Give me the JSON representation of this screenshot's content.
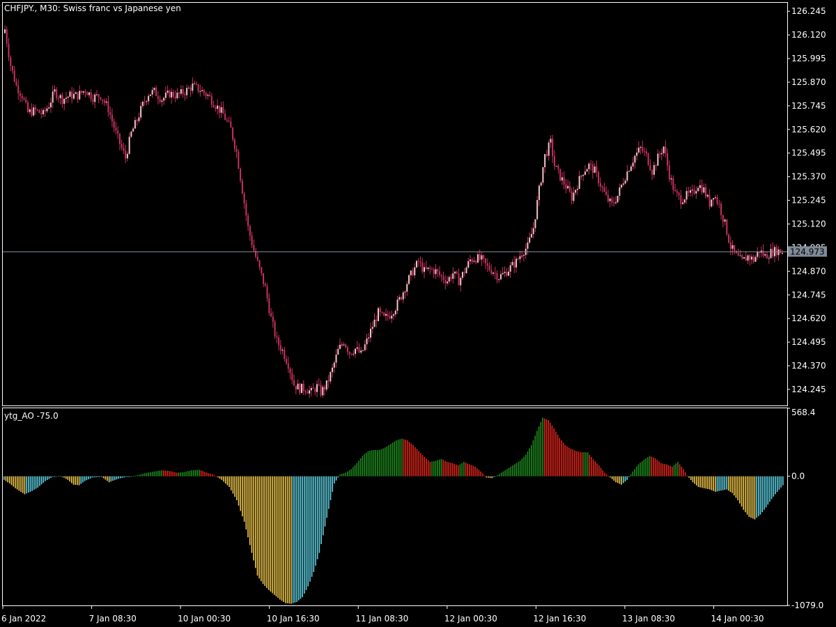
{
  "window": {
    "symbol": "CHFJPY.",
    "timeframe": "M30",
    "description": "Swiss franc vs Japanese yen",
    "title": "CHFJPY., M30:  Swiss franc vs Japanese yen"
  },
  "colors": {
    "background": "#000000",
    "frame": "#ffffff",
    "bull_candle_body": "#f2c7c7",
    "bear_candle_body": "#c8325f",
    "candle_wick": "#c8325f",
    "current_price_line": "#7f8b97",
    "current_price_tag": "#7f8b97",
    "ao_above_up": "#1e8c1e",
    "ao_above_down": "#e0251b",
    "ao_below_up": "#5fd3e6",
    "ao_below_down": "#f2c94c"
  },
  "chart_data": [
    {
      "type": "candlestick",
      "title": "CHFJPY., M30:  Swiss franc vs Japanese yen",
      "ylim": [
        124.16,
        126.29
      ],
      "yticks": [
        "126.245",
        "126.120",
        "125.995",
        "125.870",
        "125.745",
        "125.620",
        "125.495",
        "125.370",
        "125.245",
        "125.120",
        "124.995",
        "124.870",
        "124.745",
        "124.620",
        "124.495",
        "124.370",
        "124.245"
      ],
      "current_price": "124.973",
      "grid": false,
      "xticks": [
        "6 Jan 2022",
        "7 Jan 08:30",
        "10 Jan 00:30",
        "10 Jan 16:30",
        "11 Jan 08:30",
        "12 Jan 00:30",
        "12 Jan 16:30",
        "13 Jan 08:30",
        "14 Jan 00:30"
      ],
      "close_anchors": [
        [
          0,
          126.15
        ],
        [
          3,
          125.96
        ],
        [
          6,
          125.85
        ],
        [
          9,
          125.8
        ],
        [
          12,
          125.71
        ],
        [
          16,
          125.72
        ],
        [
          20,
          125.7
        ],
        [
          23,
          125.75
        ],
        [
          26,
          125.82
        ],
        [
          30,
          125.78
        ],
        [
          34,
          125.8
        ],
        [
          38,
          125.8
        ],
        [
          42,
          125.83
        ],
        [
          46,
          125.79
        ],
        [
          50,
          125.8
        ],
        [
          54,
          125.73
        ],
        [
          58,
          125.6
        ],
        [
          61,
          125.52
        ],
        [
          63,
          125.47
        ],
        [
          66,
          125.6
        ],
        [
          69,
          125.67
        ],
        [
          72,
          125.75
        ],
        [
          75,
          125.81
        ],
        [
          78,
          125.82
        ],
        [
          82,
          125.78
        ],
        [
          86,
          125.81
        ],
        [
          90,
          125.8
        ],
        [
          94,
          125.82
        ],
        [
          98,
          125.85
        ],
        [
          102,
          125.83
        ],
        [
          106,
          125.8
        ],
        [
          110,
          125.75
        ],
        [
          114,
          125.7
        ],
        [
          118,
          125.62
        ],
        [
          121,
          125.5
        ],
        [
          124,
          125.3
        ],
        [
          127,
          125.1
        ],
        [
          130,
          124.98
        ],
        [
          133,
          124.88
        ],
        [
          136,
          124.78
        ],
        [
          139,
          124.62
        ],
        [
          142,
          124.5
        ],
        [
          145,
          124.45
        ],
        [
          148,
          124.38
        ],
        [
          151,
          124.27
        ],
        [
          154,
          124.25
        ],
        [
          157,
          124.25
        ],
        [
          160,
          124.23
        ],
        [
          163,
          124.26
        ],
        [
          165,
          124.23
        ],
        [
          168,
          124.27
        ],
        [
          171,
          124.35
        ],
        [
          174,
          124.45
        ],
        [
          177,
          124.5
        ],
        [
          180,
          124.44
        ],
        [
          183,
          124.46
        ],
        [
          186,
          124.43
        ],
        [
          189,
          124.5
        ],
        [
          192,
          124.58
        ],
        [
          195,
          124.65
        ],
        [
          198,
          124.62
        ],
        [
          201,
          124.64
        ],
        [
          204,
          124.68
        ],
        [
          207,
          124.74
        ],
        [
          210,
          124.81
        ],
        [
          213,
          124.87
        ],
        [
          216,
          124.92
        ],
        [
          219,
          124.87
        ],
        [
          222,
          124.88
        ],
        [
          225,
          124.87
        ],
        [
          228,
          124.84
        ],
        [
          231,
          124.82
        ],
        [
          234,
          124.86
        ],
        [
          237,
          124.82
        ],
        [
          240,
          124.87
        ],
        [
          243,
          124.93
        ],
        [
          246,
          124.94
        ],
        [
          249,
          124.93
        ],
        [
          252,
          124.89
        ],
        [
          255,
          124.87
        ],
        [
          258,
          124.84
        ],
        [
          261,
          124.86
        ],
        [
          264,
          124.89
        ],
        [
          267,
          124.92
        ],
        [
          270,
          124.97
        ],
        [
          273,
          125.0
        ],
        [
          276,
          125.1
        ],
        [
          279,
          125.3
        ],
        [
          282,
          125.48
        ],
        [
          285,
          125.55
        ],
        [
          287,
          125.43
        ],
        [
          290,
          125.37
        ],
        [
          293,
          125.32
        ],
        [
          296,
          125.26
        ],
        [
          299,
          125.33
        ],
        [
          302,
          125.4
        ],
        [
          305,
          125.43
        ],
        [
          308,
          125.4
        ],
        [
          311,
          125.33
        ],
        [
          314,
          125.26
        ],
        [
          317,
          125.22
        ],
        [
          320,
          125.27
        ],
        [
          323,
          125.35
        ],
        [
          326,
          125.42
        ],
        [
          329,
          125.48
        ],
        [
          332,
          125.52
        ],
        [
          335,
          125.48
        ],
        [
          338,
          125.4
        ],
        [
          341,
          125.47
        ],
        [
          344,
          125.53
        ],
        [
          347,
          125.38
        ],
        [
          350,
          125.28
        ],
        [
          353,
          125.25
        ],
        [
          356,
          125.27
        ],
        [
          359,
          125.28
        ],
        [
          362,
          125.33
        ],
        [
          365,
          125.3
        ],
        [
          368,
          125.23
        ],
        [
          370,
          125.28
        ],
        [
          373,
          125.22
        ],
        [
          376,
          125.12
        ],
        [
          379,
          125.0
        ],
        [
          382,
          124.95
        ],
        [
          385,
          124.92
        ],
        [
          388,
          124.95
        ],
        [
          391,
          124.93
        ],
        [
          394,
          124.98
        ],
        [
          397,
          124.95
        ],
        [
          400,
          124.97
        ],
        [
          403,
          124.98
        ],
        [
          406,
          124.973
        ]
      ]
    },
    {
      "type": "bar",
      "title": "ytg_AO -75.0",
      "ylim": [
        -1079.0,
        568.4
      ],
      "yticks": [
        "568.4",
        "0.0",
        "-1079.0"
      ],
      "series_name": "ytg_AO",
      "last_value": "-75.0",
      "anchors": [
        [
          0,
          -30
        ],
        [
          3,
          -60
        ],
        [
          6,
          -100
        ],
        [
          9,
          -130
        ],
        [
          11,
          -150
        ],
        [
          14,
          -130
        ],
        [
          18,
          -95
        ],
        [
          22,
          -40
        ],
        [
          26,
          -5
        ],
        [
          30,
          5
        ],
        [
          34,
          -30
        ],
        [
          37,
          -70
        ],
        [
          40,
          -75
        ],
        [
          43,
          -40
        ],
        [
          47,
          -10
        ],
        [
          52,
          -5
        ],
        [
          56,
          -50
        ],
        [
          61,
          -20
        ],
        [
          66,
          -3
        ],
        [
          70,
          5
        ],
        [
          75,
          25
        ],
        [
          80,
          40
        ],
        [
          84,
          50
        ],
        [
          88,
          45
        ],
        [
          92,
          30
        ],
        [
          96,
          35
        ],
        [
          100,
          50
        ],
        [
          104,
          55
        ],
        [
          108,
          30
        ],
        [
          112,
          10
        ],
        [
          116,
          -30
        ],
        [
          120,
          -90
        ],
        [
          124,
          -200
        ],
        [
          128,
          -380
        ],
        [
          132,
          -640
        ],
        [
          135,
          -830
        ],
        [
          138,
          -900
        ],
        [
          141,
          -950
        ],
        [
          144,
          -990
        ],
        [
          147,
          -1030
        ],
        [
          150,
          -1060
        ],
        [
          153,
          -1065
        ],
        [
          156,
          -1050
        ],
        [
          159,
          -1010
        ],
        [
          162,
          -920
        ],
        [
          165,
          -800
        ],
        [
          168,
          -640
        ],
        [
          171,
          -420
        ],
        [
          174,
          -200
        ],
        [
          176,
          -60
        ],
        [
          179,
          15
        ],
        [
          182,
          30
        ],
        [
          185,
          60
        ],
        [
          188,
          110
        ],
        [
          191,
          170
        ],
        [
          194,
          210
        ],
        [
          197,
          220
        ],
        [
          200,
          220
        ],
        [
          203,
          240
        ],
        [
          206,
          270
        ],
        [
          209,
          300
        ],
        [
          212,
          315
        ],
        [
          215,
          300
        ],
        [
          218,
          260
        ],
        [
          221,
          210
        ],
        [
          224,
          160
        ],
        [
          227,
          120
        ],
        [
          230,
          130
        ],
        [
          233,
          145
        ],
        [
          236,
          120
        ],
        [
          239,
          110
        ],
        [
          242,
          90
        ],
        [
          245,
          120
        ],
        [
          248,
          100
        ],
        [
          251,
          80
        ],
        [
          254,
          40
        ],
        [
          257,
          -10
        ],
        [
          260,
          -15
        ],
        [
          263,
          10
        ],
        [
          266,
          40
        ],
        [
          269,
          70
        ],
        [
          272,
          100
        ],
        [
          275,
          130
        ],
        [
          278,
          180
        ],
        [
          281,
          260
        ],
        [
          284,
          380
        ],
        [
          287,
          490
        ],
        [
          290,
          470
        ],
        [
          293,
          400
        ],
        [
          296,
          320
        ],
        [
          299,
          260
        ],
        [
          302,
          230
        ],
        [
          305,
          210
        ],
        [
          308,
          200
        ],
        [
          311,
          200
        ],
        [
          314,
          140
        ],
        [
          317,
          90
        ],
        [
          320,
          30
        ],
        [
          323,
          -10
        ],
        [
          326,
          -50
        ],
        [
          329,
          -70
        ],
        [
          332,
          -30
        ],
        [
          335,
          40
        ],
        [
          338,
          100
        ],
        [
          341,
          140
        ],
        [
          344,
          170
        ],
        [
          347,
          150
        ],
        [
          350,
          110
        ],
        [
          353,
          100
        ],
        [
          356,
          80
        ],
        [
          359,
          120
        ],
        [
          362,
          60
        ],
        [
          364,
          5
        ],
        [
          367,
          -50
        ],
        [
          370,
          -90
        ],
        [
          373,
          -100
        ],
        [
          376,
          -110
        ],
        [
          379,
          -130
        ],
        [
          382,
          -120
        ],
        [
          385,
          -110
        ],
        [
          388,
          -140
        ],
        [
          391,
          -200
        ],
        [
          394,
          -280
        ],
        [
          397,
          -340
        ],
        [
          400,
          -360
        ],
        [
          403,
          -320
        ],
        [
          406,
          -260
        ],
        [
          409,
          -190
        ],
        [
          412,
          -130
        ],
        [
          415,
          -75
        ]
      ]
    }
  ]
}
